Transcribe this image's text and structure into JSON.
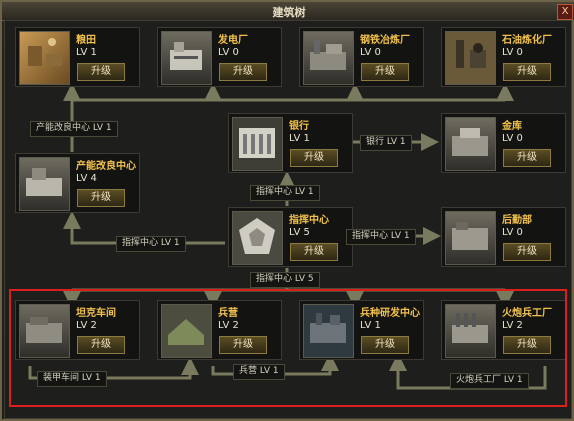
{
  "window": {
    "title": "建筑树",
    "close_label": "X"
  },
  "upgrade_label": "升级",
  "buildings": {
    "grain_field": {
      "name": "粮田",
      "level": "LV 1"
    },
    "power_plant": {
      "name": "发电厂",
      "level": "LV 0"
    },
    "steel_mill": {
      "name": "钢铁冶炼厂",
      "level": "LV 0"
    },
    "oil_refinery": {
      "name": "石油炼化厂",
      "level": "LV 0"
    },
    "bank": {
      "name": "银行",
      "level": "LV 1"
    },
    "vault": {
      "name": "金库",
      "level": "LV 0"
    },
    "yield_center": {
      "name": "产能改良中心",
      "level": "LV 4"
    },
    "command_center": {
      "name": "指挥中心",
      "level": "LV 5"
    },
    "logistics": {
      "name": "后勤部",
      "level": "LV 0"
    },
    "tank_workshop": {
      "name": "坦克车间",
      "level": "LV 2"
    },
    "barracks": {
      "name": "兵营",
      "level": "LV 2"
    },
    "arms_research": {
      "name": "兵种研发中心",
      "level": "LV 1"
    },
    "artillery_factory": {
      "name": "火炮兵工厂",
      "level": "LV 2"
    }
  },
  "requirements": {
    "yield_center_lv1": "产能改良中心 LV 1",
    "bank_lv1": "银行 LV 1",
    "command_lv1_upper": "指挥中心 LV 1",
    "command_lv1_left": "指挥中心 LV 1",
    "command_lv1_right": "指挥中心 LV 1",
    "command_lv5": "指挥中心 LV 5",
    "armored_workshop_lv1": "装甲车间 LV 1",
    "barracks_lv1": "兵营 LV 1",
    "artillery_factory_lv1": "火炮兵工厂 LV 1"
  },
  "colors": {
    "line": "#7a7a5e",
    "highlight": "#dd1f1b",
    "name_text": "#f2c14e"
  }
}
